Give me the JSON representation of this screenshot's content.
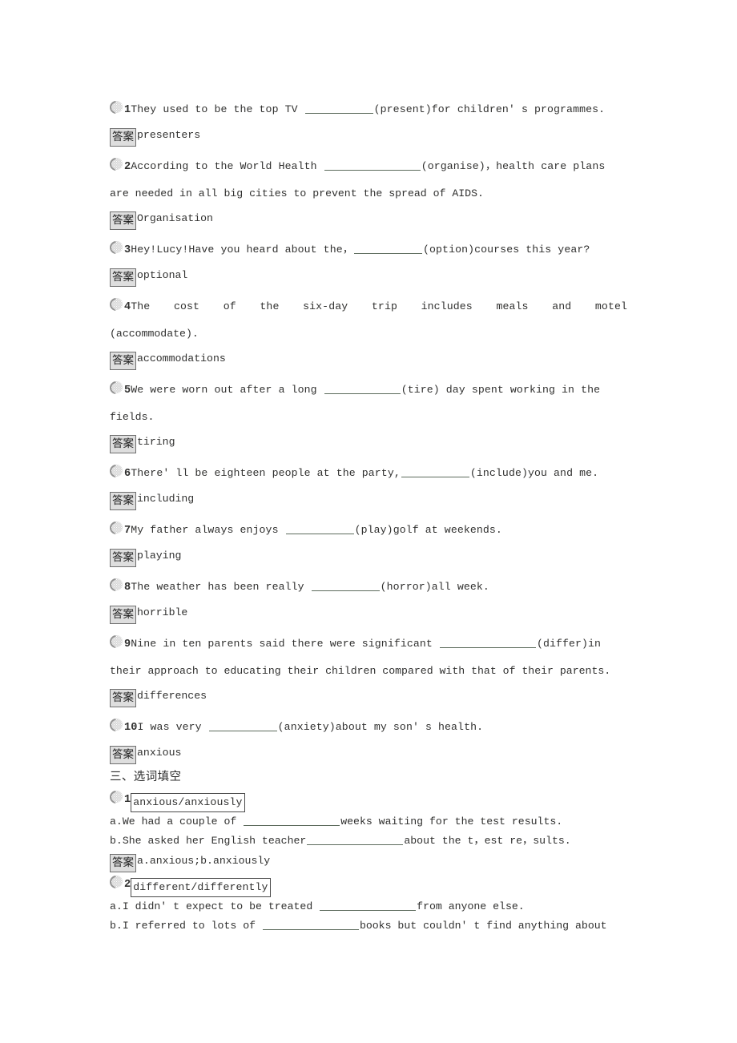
{
  "answer_tag": "答案",
  "section_heading": "三、选词填空",
  "blank_color": "#5c6b5c",
  "tag_bg": "#dedede",
  "items": [
    {
      "number": "1",
      "pre": "They used to be the top TV ",
      "blank": "b85",
      "post": "(present)for children' s programmes.",
      "answer": "presenters"
    },
    {
      "number": "2",
      "pre": "According to the World Health ",
      "blank": "b120",
      "post": "(organise)，health care plans",
      "cont": "are needed in all big cities to prevent the spread of AIDS.",
      "answer": "Organisation"
    },
    {
      "number": "3",
      "pre": "Hey!Lucy!Have you heard about the，",
      "blank": "b85",
      "post": "(option)courses this year?",
      "answer": "optional"
    },
    {
      "number": "4",
      "spread_words": [
        "The",
        "cost",
        "of",
        "the",
        "six-day",
        "trip",
        "includes",
        "meals",
        "and",
        "motel"
      ],
      "cont": "(accommodate).",
      "answer": "accommodations"
    },
    {
      "number": "5",
      "pre": "We were worn out after a long ",
      "blank": "b95",
      "post": "(tire) day spent working in the",
      "cont": "fields.",
      "answer": "tiring"
    },
    {
      "number": "6",
      "pre": "There' ll be eighteen people at the party,",
      "blank": "b85",
      "post": "(include)you and me.",
      "answer": "including"
    },
    {
      "number": "7",
      "pre": "My father always enjoys ",
      "blank": "b85",
      "post": "(play)golf at weekends.",
      "answer": "playing"
    },
    {
      "number": "8",
      "pre": "The weather has been really ",
      "blank": "b85",
      "post": "(horror)all week.",
      "answer": "horrible"
    },
    {
      "number": "9",
      "pre": "Nine in ten parents said there were significant ",
      "blank": "b120",
      "post": "(differ)in",
      "cont": "their approach to educating their children compared with that of their parents.",
      "answer": "differences"
    },
    {
      "number": "10",
      "pre": "I was very ",
      "blank": "b85",
      "post": "(anxiety)about my son' s health.",
      "answer": "anxious"
    }
  ],
  "word_choice": [
    {
      "number": "1",
      "word_pair": "anxious/anxiously",
      "a_pre": "a.We had a couple of ",
      "a_blank": "b120",
      "a_post": "weeks waiting for the test results.",
      "b_pre": "b.She asked her English teacher",
      "b_blank": "b120",
      "b_post": "about the t，est re，sults.",
      "answer": "a.anxious;b.anxiously"
    },
    {
      "number": "2",
      "word_pair": "different/differently",
      "a_pre": "a.I didn' t expect to be treated ",
      "a_blank": "b120",
      "a_post": "from anyone else.",
      "b_pre": "b.I referred to lots of ",
      "b_blank": "b120",
      "b_post": "books but couldn' t find anything about",
      "answer": null
    }
  ]
}
